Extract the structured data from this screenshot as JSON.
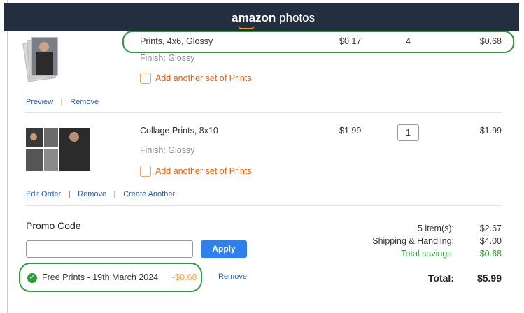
{
  "header": {
    "logo_bold": "amazon",
    "logo_light": "photos"
  },
  "items": [
    {
      "name": "Prints, 4x6, Glossy",
      "finish": "Finish: Glossy",
      "price": "$0.17",
      "quantity": "4",
      "total": "$0.68",
      "add_another": "Add another set of Prints",
      "actions": [
        "Preview",
        "Remove"
      ]
    },
    {
      "name": "Collage Prints, 8x10",
      "finish": "Finish: Glossy",
      "price": "$1.99",
      "quantity": "1",
      "total": "$1.99",
      "add_another": "Add another set of Prints",
      "actions": [
        "Edit Order",
        "Remove",
        "Create Another"
      ]
    }
  ],
  "promo": {
    "heading": "Promo Code",
    "input_value": "",
    "apply_label": "Apply",
    "applied_code": "Free Prints - 19th March 2024",
    "applied_discount": "-$0.68",
    "remove_label": "Remove"
  },
  "summary": {
    "items_label": "5 item(s):",
    "items_value": "$2.67",
    "shipping_label": "Shipping & Handling:",
    "shipping_value": "$4.00",
    "savings_label": "Total savings:",
    "savings_value": "-$0.68",
    "total_label": "Total:",
    "total_value": "$5.99"
  },
  "colors": {
    "header_bg": "#232f3e",
    "accent_orange": "#f05a00",
    "link_blue": "#1f5fbf",
    "highlight_green": "#2e9a3c",
    "button_blue": "#2f80ed"
  }
}
